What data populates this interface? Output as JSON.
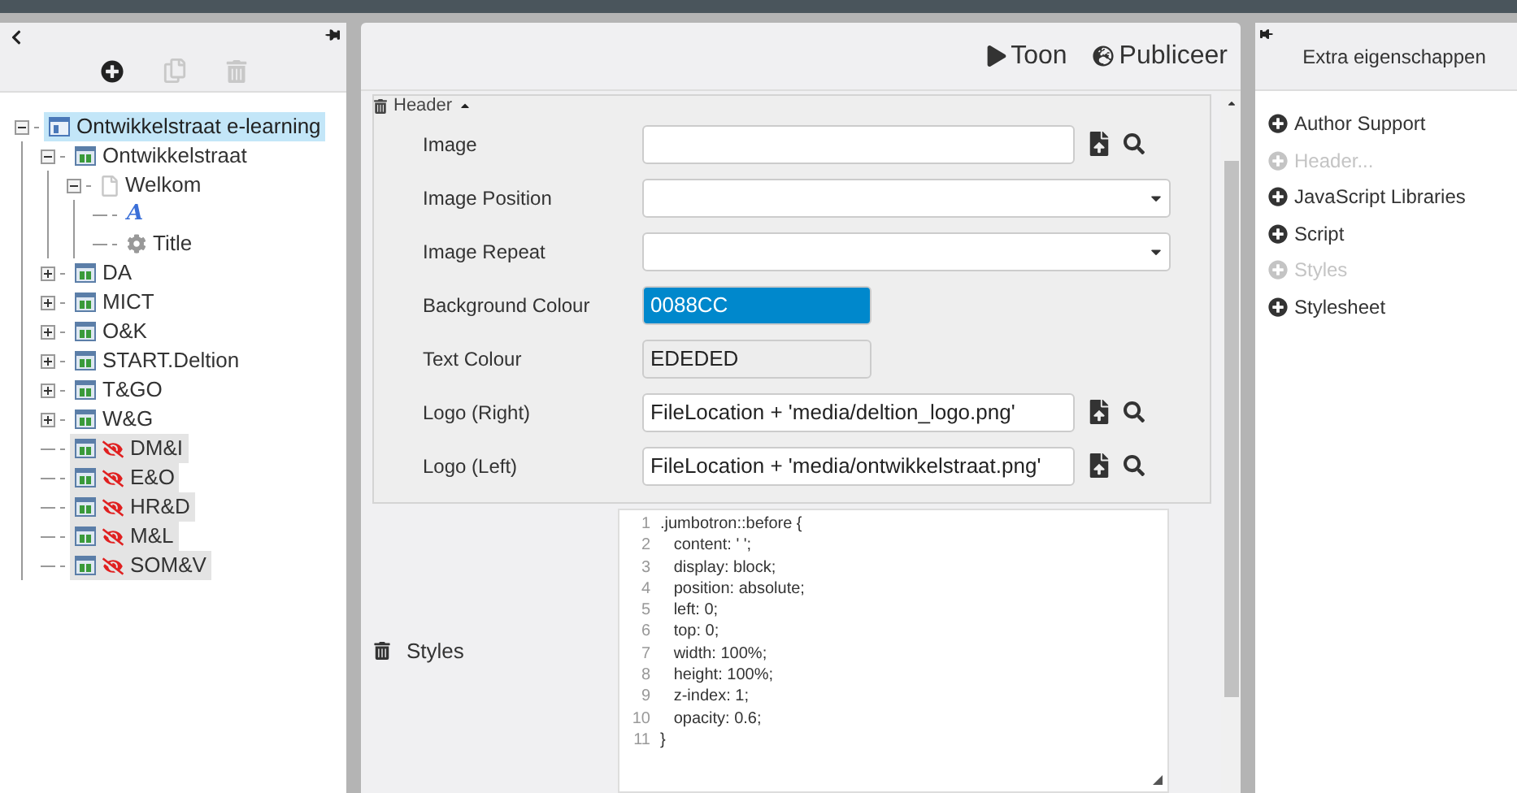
{
  "left_panel": {
    "toolbar": [
      {
        "kind": "add",
        "disabled": false
      },
      {
        "kind": "copy",
        "disabled": true
      },
      {
        "kind": "delete",
        "disabled": true
      }
    ],
    "tree": [
      {
        "label": "Ontwikkelstraat e-learning",
        "kind": "project",
        "selected": true,
        "hidden": false,
        "expanded": true,
        "children": [
          {
            "label": "Ontwikkelstraat",
            "kind": "course",
            "selected": false,
            "hidden": false,
            "expanded": true,
            "children": [
              {
                "label": "Welkom",
                "kind": "page",
                "selected": false,
                "hidden": false,
                "expanded": true,
                "children": [
                  {
                    "label": "A",
                    "kind": "text",
                    "selected": false,
                    "hidden": false
                  },
                  {
                    "label": "Title",
                    "kind": "setting",
                    "selected": false,
                    "hidden": false
                  }
                ]
              }
            ]
          },
          {
            "label": "DA",
            "kind": "course",
            "selected": false,
            "hidden": false,
            "expanded": false
          },
          {
            "label": "MICT",
            "kind": "course",
            "selected": false,
            "hidden": false,
            "expanded": false
          },
          {
            "label": "O&K",
            "kind": "course",
            "selected": false,
            "hidden": false,
            "expanded": false
          },
          {
            "label": "START.Deltion",
            "kind": "course",
            "selected": false,
            "hidden": false,
            "expanded": false
          },
          {
            "label": "T&GO",
            "kind": "course",
            "selected": false,
            "hidden": false,
            "expanded": false
          },
          {
            "label": "W&G",
            "kind": "course",
            "selected": false,
            "hidden": false,
            "expanded": false
          },
          {
            "label": "DM&I",
            "kind": "course",
            "selected": false,
            "hidden": true
          },
          {
            "label": "E&O",
            "kind": "course",
            "selected": false,
            "hidden": true
          },
          {
            "label": "HR&D",
            "kind": "course",
            "selected": false,
            "hidden": true
          },
          {
            "label": "M&L",
            "kind": "course",
            "selected": false,
            "hidden": true
          },
          {
            "label": "SOM&V",
            "kind": "course",
            "selected": false,
            "hidden": true
          }
        ]
      }
    ]
  },
  "toolbar": [
    {
      "kind": "play",
      "label": "Toon"
    },
    {
      "kind": "publish",
      "label": "Publiceer"
    }
  ],
  "header_section": {
    "title": "Header",
    "expanded": true,
    "fields": [
      {
        "label": "Image",
        "kind": "file"
      },
      {
        "label": "Image Position",
        "kind": "select"
      },
      {
        "label": "Image Repeat",
        "kind": "select"
      },
      {
        "label": "Background Colour",
        "kind": "color",
        "value": "0088CC",
        "color": "#0088cc"
      },
      {
        "label": "Text Colour",
        "kind": "color",
        "value": "EDEDED",
        "color": "#ededed"
      },
      {
        "label": "Logo (Right)",
        "kind": "file",
        "value": "FileLocation + 'media/deltion_logo.png'"
      },
      {
        "label": "Logo (Left)",
        "kind": "file",
        "value": "FileLocation + 'media/ontwikkelstraat.png'"
      }
    ]
  },
  "styles": {
    "label": "Styles",
    "lines": [
      {
        "number": "1",
        "text": ".jumbotron::before {"
      },
      {
        "number": "2",
        "text": "   content: ' ';"
      },
      {
        "number": "3",
        "text": "   display: block;"
      },
      {
        "number": "4",
        "text": "   position: absolute;"
      },
      {
        "number": "5",
        "text": "   left: 0;"
      },
      {
        "number": "6",
        "text": "   top: 0;"
      },
      {
        "number": "7",
        "text": "   width: 100%;"
      },
      {
        "number": "8",
        "text": "   height: 100%;"
      },
      {
        "number": "9",
        "text": "   z-index: 1;"
      },
      {
        "number": "10",
        "text": "   opacity: 0.6;"
      },
      {
        "number": "11",
        "text": "}"
      }
    ]
  },
  "right_panel": {
    "title": "Extra eigenschappen",
    "items": [
      {
        "label": "Author Support",
        "disabled": false
      },
      {
        "label": "Header...",
        "disabled": true
      },
      {
        "label": "JavaScript Libraries",
        "disabled": false
      },
      {
        "label": "Script",
        "disabled": false
      },
      {
        "label": "Styles",
        "disabled": true
      },
      {
        "label": "Stylesheet",
        "disabled": false
      }
    ]
  }
}
